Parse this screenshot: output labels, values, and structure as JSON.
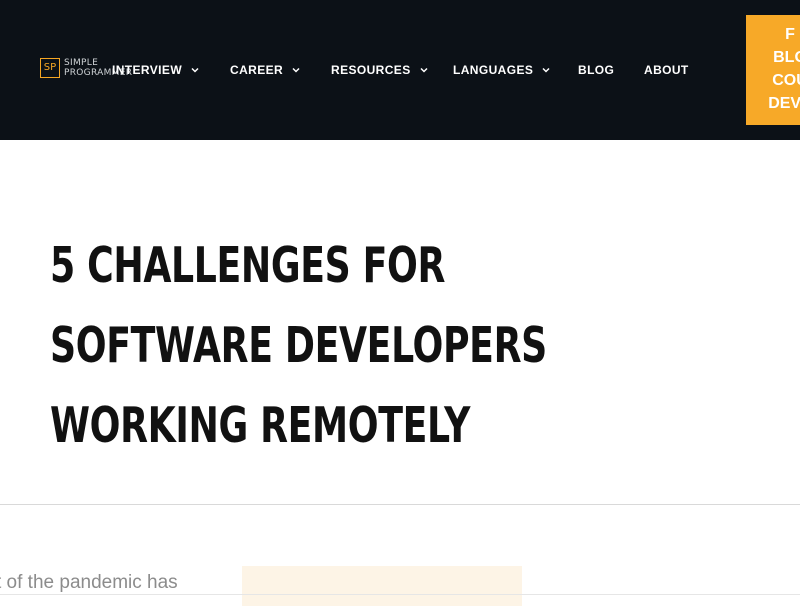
{
  "header": {
    "logo_mark": "SP",
    "logo_line1": "SIMPLE",
    "logo_line2": "PROGRAMMER",
    "nav": [
      {
        "label": "INTERVIEW",
        "has_dropdown": true
      },
      {
        "label": "CAREER",
        "has_dropdown": true
      },
      {
        "label": "RESOURCES",
        "has_dropdown": true
      },
      {
        "label": "LANGUAGES",
        "has_dropdown": true
      },
      {
        "label": "BLOG",
        "has_dropdown": false
      },
      {
        "label": "ABOUT",
        "has_dropdown": false
      }
    ],
    "cta_lines": [
      "F",
      "BLO",
      "COU",
      "DEVE"
    ]
  },
  "article": {
    "title_lines": [
      "5 CHALLENGES FOR",
      "SOFTWARE DEVELOPERS",
      "WORKING REMOTELY"
    ],
    "excerpt": "t of the pandemic has"
  },
  "colors": {
    "header_bg": "#0c1117",
    "accent": "#f7a928",
    "title_text": "#111111",
    "ad_bg": "#fdf4e6"
  }
}
